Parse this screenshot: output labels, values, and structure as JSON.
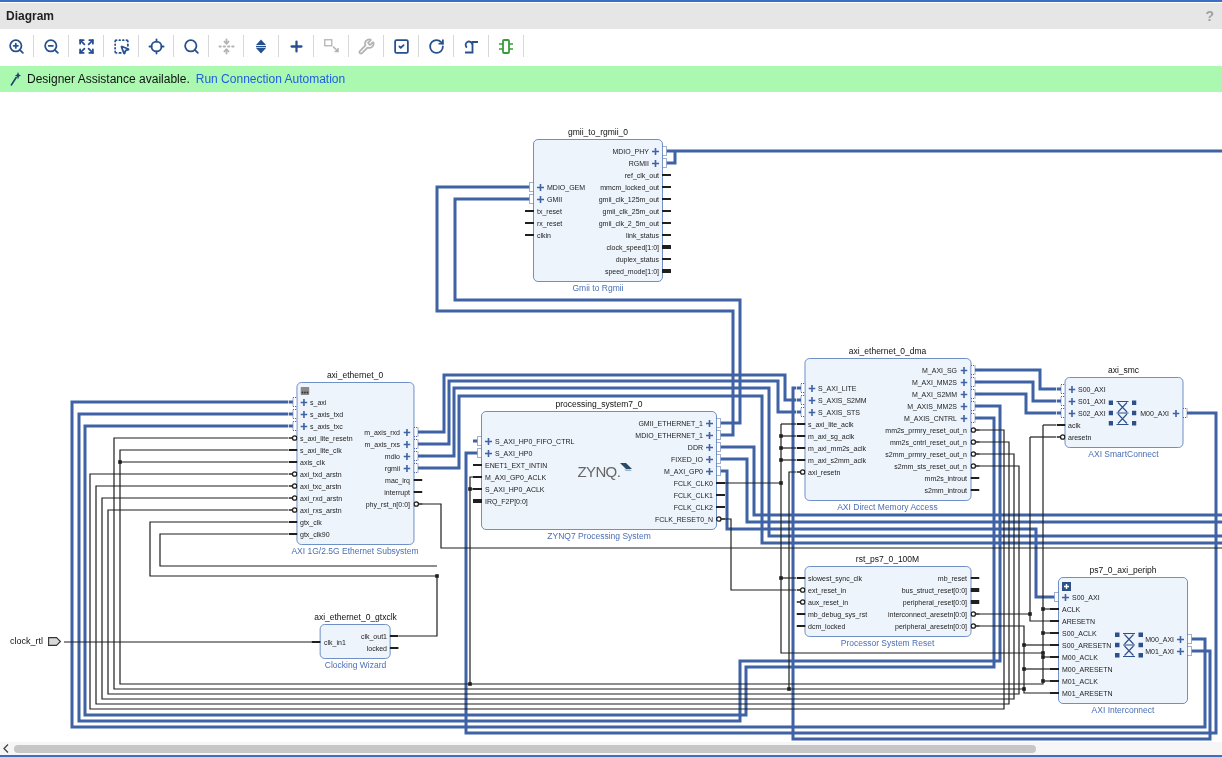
{
  "window": {
    "title": "Diagram",
    "help": "?"
  },
  "toolbar": [
    {
      "kind": "zoomin",
      "disabled": false
    },
    {
      "kind": "zoomout",
      "disabled": false
    },
    {
      "kind": "fit",
      "disabled": false
    },
    {
      "kind": "area",
      "disabled": false
    },
    {
      "kind": "center",
      "disabled": false
    },
    {
      "kind": "search",
      "disabled": false
    },
    {
      "kind": "collapse",
      "disabled": true
    },
    {
      "kind": "expand",
      "disabled": false
    },
    {
      "kind": "add",
      "disabled": false
    },
    {
      "kind": "connect",
      "disabled": true
    },
    {
      "kind": "wrench",
      "disabled": true
    },
    {
      "kind": "validate",
      "disabled": false
    },
    {
      "kind": "reload",
      "disabled": false
    },
    {
      "kind": "route",
      "disabled": false
    },
    {
      "kind": "port",
      "disabled": false
    }
  ],
  "banner": {
    "message": "Designer Assistance available.",
    "link": "Run Connection Automation"
  },
  "diagram": {
    "blocks": [
      {
        "name": "gmii_to_rgmii_0",
        "ip": "Gmii to Rgmii",
        "kind": "plain",
        "left": [
          {
            "label": "MDIO_GEM",
            "kind": "bus"
          },
          {
            "label": "GMII",
            "kind": "bus"
          },
          {
            "label": "tx_reset",
            "kind": "signal"
          },
          {
            "label": "rx_reset",
            "kind": "signal"
          },
          {
            "label": "clkin",
            "kind": "signal"
          }
        ],
        "right": [
          {
            "label": "MDIO_PHY",
            "kind": "bus"
          },
          {
            "label": "RGMII",
            "kind": "bus"
          },
          {
            "label": "ref_clk_out",
            "kind": "signal"
          },
          {
            "label": "mmcm_locked_out",
            "kind": "signal"
          },
          {
            "label": "gmii_clk_125m_out",
            "kind": "signal"
          },
          {
            "label": "gmii_clk_25m_out",
            "kind": "signal"
          },
          {
            "label": "gmii_clk_2_5m_out",
            "kind": "signal"
          },
          {
            "label": "link_status",
            "kind": "signal"
          },
          {
            "label": "clock_speed[1:0]",
            "kind": "vector"
          },
          {
            "label": "duplex_status",
            "kind": "signal"
          },
          {
            "label": "speed_mode[1:0]",
            "kind": "vector"
          }
        ]
      },
      {
        "name": "axi_ethernet_0",
        "ip": "AXI 1G/2.5G Ethernet Subsystem",
        "kind": "subsystem",
        "left": [
          {
            "label": "s_axi",
            "kind": "bus"
          },
          {
            "label": "s_axis_txd",
            "kind": "bus"
          },
          {
            "label": "s_axis_txc",
            "kind": "bus"
          },
          {
            "label": "s_axi_lite_resetn",
            "kind": "reset"
          },
          {
            "label": "s_axi_lite_clk",
            "kind": "signal"
          },
          {
            "label": "axis_clk",
            "kind": "signal"
          },
          {
            "label": "axi_txd_arstn",
            "kind": "reset"
          },
          {
            "label": "axi_txc_arstn",
            "kind": "reset"
          },
          {
            "label": "axi_rxd_arstn",
            "kind": "reset"
          },
          {
            "label": "axi_rxs_arstn",
            "kind": "reset"
          },
          {
            "label": "gtx_clk",
            "kind": "signal"
          },
          {
            "label": "gtx_clk90",
            "kind": "signal"
          }
        ],
        "right": [
          {
            "label": "m_axis_rxd",
            "kind": "bus"
          },
          {
            "label": "m_axis_rxs",
            "kind": "bus"
          },
          {
            "label": "mdio",
            "kind": "bus"
          },
          {
            "label": "rgmii",
            "kind": "bus"
          },
          {
            "label": "mac_irq",
            "kind": "signal"
          },
          {
            "label": "interrupt",
            "kind": "signal"
          },
          {
            "label": "phy_rst_n[0:0]",
            "kind": "reset"
          }
        ]
      },
      {
        "name": "processing_system7_0",
        "ip": "ZYNQ7 Processing System",
        "kind": "processor",
        "logo": "ZYNQ.",
        "left": [
          {
            "label": "S_AXI_HP0_FIFO_CTRL",
            "kind": "bus"
          },
          {
            "label": "S_AXI_HP0",
            "kind": "bus"
          },
          {
            "label": "ENET1_EXT_INTIN",
            "kind": "signal"
          },
          {
            "label": "M_AXI_GP0_ACLK",
            "kind": "signal"
          },
          {
            "label": "S_AXI_HP0_ACLK",
            "kind": "signal"
          },
          {
            "label": "IRQ_F2P[0:0]",
            "kind": "vector"
          }
        ],
        "right": [
          {
            "label": "GMII_ETHERNET_1",
            "kind": "bus"
          },
          {
            "label": "MDIO_ETHERNET_1",
            "kind": "bus"
          },
          {
            "label": "DDR",
            "kind": "bus"
          },
          {
            "label": "FIXED_IO",
            "kind": "bus"
          },
          {
            "label": "M_AXI_GP0",
            "kind": "bus"
          },
          {
            "label": "FCLK_CLK0",
            "kind": "signal"
          },
          {
            "label": "FCLK_CLK1",
            "kind": "signal"
          },
          {
            "label": "FCLK_CLK2",
            "kind": "signal"
          },
          {
            "label": "FCLK_RESET0_N",
            "kind": "reset"
          }
        ]
      },
      {
        "name": "axi_ethernet_0_dma",
        "ip": "AXI Direct Memory Access",
        "kind": "plain",
        "left": [
          {
            "label": "S_AXI_LITE",
            "kind": "bus"
          },
          {
            "label": "S_AXIS_S2MM",
            "kind": "bus"
          },
          {
            "label": "S_AXIS_STS",
            "kind": "bus"
          },
          {
            "label": "s_axi_lite_aclk",
            "kind": "signal"
          },
          {
            "label": "m_axi_sg_aclk",
            "kind": "signal"
          },
          {
            "label": "m_axi_mm2s_aclk",
            "kind": "signal"
          },
          {
            "label": "m_axi_s2mm_aclk",
            "kind": "signal"
          },
          {
            "label": "axi_resetn",
            "kind": "reset"
          }
        ],
        "right": [
          {
            "label": "M_AXI_SG",
            "kind": "bus"
          },
          {
            "label": "M_AXI_MM2S",
            "kind": "bus"
          },
          {
            "label": "M_AXI_S2MM",
            "kind": "bus"
          },
          {
            "label": "M_AXIS_MM2S",
            "kind": "bus"
          },
          {
            "label": "M_AXIS_CNTRL",
            "kind": "bus"
          },
          {
            "label": "mm2s_prmry_reset_out_n",
            "kind": "reset"
          },
          {
            "label": "mm2s_cntrl_reset_out_n",
            "kind": "reset"
          },
          {
            "label": "s2mm_prmry_reset_out_n",
            "kind": "reset"
          },
          {
            "label": "s2mm_sts_reset_out_n",
            "kind": "reset"
          },
          {
            "label": "mm2s_introut",
            "kind": "signal"
          },
          {
            "label": "s2mm_introut",
            "kind": "signal"
          }
        ]
      },
      {
        "name": "axi_smc",
        "ip": "AXI SmartConnect",
        "kind": "crossbar",
        "left": [
          {
            "label": "S00_AXI",
            "kind": "bus"
          },
          {
            "label": "S01_AXI",
            "kind": "bus"
          },
          {
            "label": "S02_AXI",
            "kind": "bus"
          },
          {
            "label": "aclk",
            "kind": "signal"
          },
          {
            "label": "aresetn",
            "kind": "reset"
          }
        ],
        "right": [
          {
            "label": "M00_AXI",
            "kind": "bus"
          }
        ]
      },
      {
        "name": "axi_ethernet_0_gtxclk",
        "ip": "Clocking Wizard",
        "kind": "plain",
        "left": [
          {
            "label": "clk_in1",
            "kind": "signal"
          }
        ],
        "right": [
          {
            "label": "clk_out1",
            "kind": "signal"
          },
          {
            "label": "locked",
            "kind": "signal"
          }
        ]
      },
      {
        "name": "rst_ps7_0_100M",
        "ip": "Processor System Reset",
        "kind": "plain",
        "left": [
          {
            "label": "slowest_sync_clk",
            "kind": "signal"
          },
          {
            "label": "ext_reset_in",
            "kind": "reset"
          },
          {
            "label": "aux_reset_in",
            "kind": "reset"
          },
          {
            "label": "mb_debug_sys_rst",
            "kind": "signal"
          },
          {
            "label": "dcm_locked",
            "kind": "signal"
          }
        ],
        "right": [
          {
            "label": "mb_reset",
            "kind": "signal"
          },
          {
            "label": "bus_struct_reset[0:0]",
            "kind": "vector"
          },
          {
            "label": "peripheral_reset[0:0]",
            "kind": "vector"
          },
          {
            "label": "interconnect_aresetn[0:0]",
            "kind": "reset"
          },
          {
            "label": "peripheral_aresetn[0:0]",
            "kind": "reset"
          }
        ]
      },
      {
        "name": "ps7_0_axi_periph",
        "ip": "AXI Interconnect",
        "kind": "hierarchy",
        "left": [
          {
            "label": "S00_AXI",
            "kind": "bus"
          },
          {
            "label": "ACLK",
            "kind": "signal"
          },
          {
            "label": "ARESETN",
            "kind": "signal"
          },
          {
            "label": "S00_ACLK",
            "kind": "signal"
          },
          {
            "label": "S00_ARESETN",
            "kind": "signal"
          },
          {
            "label": "M00_ACLK",
            "kind": "signal"
          },
          {
            "label": "M00_ARESETN",
            "kind": "signal"
          },
          {
            "label": "M01_ACLK",
            "kind": "signal"
          },
          {
            "label": "M01_ARESETN",
            "kind": "signal"
          }
        ],
        "right": [
          {
            "label": "M00_AXI",
            "kind": "bus"
          },
          {
            "label": "M01_AXI",
            "kind": "bus"
          }
        ]
      }
    ],
    "external_ports": [
      {
        "label": "clock_rtl"
      }
    ]
  }
}
